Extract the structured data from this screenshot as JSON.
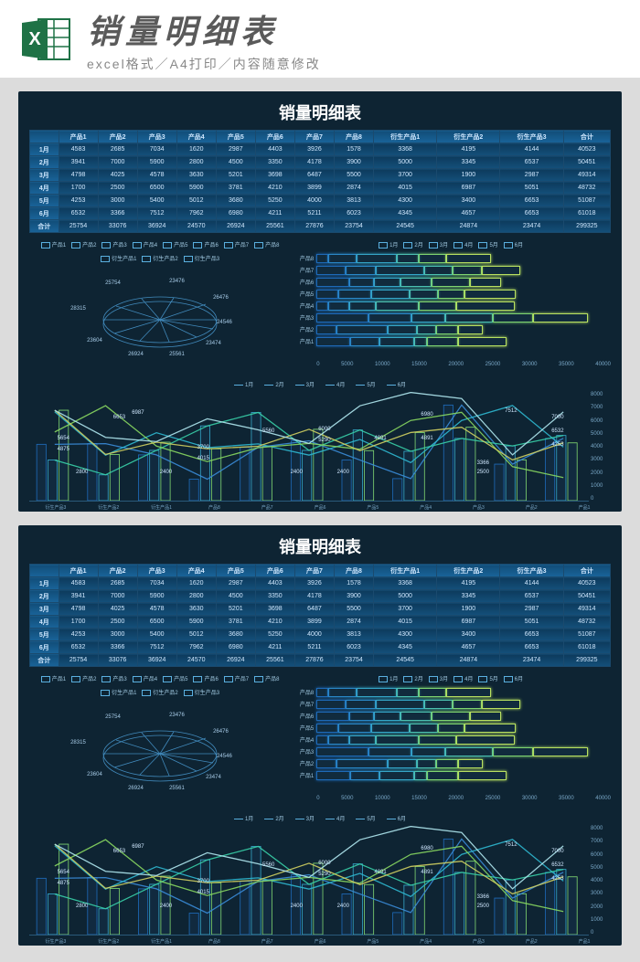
{
  "header": {
    "title": "销量明细表",
    "subtitle": "excel格式／A4打印／内容随意修改"
  },
  "dashboard_title": "销量明细表",
  "columns": [
    "",
    "产品1",
    "产品2",
    "产品3",
    "产品4",
    "产品5",
    "产品6",
    "产品7",
    "产品8",
    "衍生产品1",
    "衍生产品2",
    "衍生产品3",
    "合计"
  ],
  "rows": [
    {
      "label": "1月",
      "cells": [
        4583,
        2685,
        7034,
        1620,
        2987,
        4403,
        3926,
        1578,
        3368,
        4195,
        4144,
        40523
      ]
    },
    {
      "label": "2月",
      "cells": [
        3941,
        7000,
        5900,
        2800,
        4500,
        3350,
        4178,
        3900,
        5000,
        3345,
        6537,
        50451
      ]
    },
    {
      "label": "3月",
      "cells": [
        4798,
        4025,
        4578,
        3630,
        5201,
        3698,
        6487,
        5500,
        3700,
        1900,
        2987,
        49314
      ]
    },
    {
      "label": "4月",
      "cells": [
        1700,
        2500,
        6500,
        5900,
        3781,
        4210,
        3899,
        2874,
        4015,
        6987,
        5051,
        48732
      ]
    },
    {
      "label": "5月",
      "cells": [
        4253,
        3000,
        5400,
        5012,
        3680,
        5250,
        4000,
        3813,
        4300,
        3400,
        6653,
        51087
      ]
    },
    {
      "label": "6月",
      "cells": [
        6532,
        3366,
        7512,
        7962,
        6980,
        4211,
        5211,
        6023,
        4345,
        4657,
        6653,
        61018
      ]
    },
    {
      "label": "合计",
      "cells": [
        25754,
        33076,
        36924,
        24570,
        26924,
        25561,
        27876,
        23754,
        24545,
        24874,
        23474,
        299325
      ]
    }
  ],
  "chart_data": {
    "table": {
      "type": "table",
      "title": "销量明细表",
      "columns": [
        "月份",
        "产品1",
        "产品2",
        "产品3",
        "产品4",
        "产品5",
        "产品6",
        "产品7",
        "产品8",
        "衍生产品1",
        "衍生产品2",
        "衍生产品3",
        "合计"
      ],
      "rows": [
        [
          "1月",
          4583,
          2685,
          7034,
          1620,
          2987,
          4403,
          3926,
          1578,
          3368,
          4195,
          4144,
          40523
        ],
        [
          "2月",
          3941,
          7000,
          5900,
          2800,
          4500,
          3350,
          4178,
          3900,
          5000,
          3345,
          6537,
          50451
        ],
        [
          "3月",
          4798,
          4025,
          4578,
          3630,
          5201,
          3698,
          6487,
          5500,
          3700,
          1900,
          2987,
          49314
        ],
        [
          "4月",
          1700,
          2500,
          6500,
          5900,
          3781,
          4210,
          3899,
          2874,
          4015,
          6987,
          5051,
          48732
        ],
        [
          "5月",
          4253,
          3000,
          5400,
          5012,
          3680,
          5250,
          4000,
          3813,
          4300,
          3400,
          6653,
          51087
        ],
        [
          "6月",
          6532,
          3366,
          7512,
          7962,
          6980,
          4211,
          5211,
          6023,
          4345,
          4657,
          6653,
          61018
        ],
        [
          "合计",
          25754,
          33076,
          36924,
          24570,
          26924,
          25561,
          27876,
          23754,
          24545,
          24874,
          23474,
          299325
        ]
      ]
    },
    "pie": {
      "type": "pie",
      "title": "产品合计占比（线框饼图）",
      "categories": [
        "产品1",
        "产品2",
        "产品3",
        "产品4",
        "产品5",
        "产品6",
        "产品7",
        "产品8",
        "衍生产品1",
        "衍生产品2",
        "衍生产品3"
      ],
      "values": [
        25754,
        33076,
        36924,
        24570,
        26924,
        25561,
        27876,
        23754,
        24545,
        24874,
        23474
      ],
      "data_labels_visible": [
        28315,
        25754,
        23604,
        23476,
        26476,
        24546,
        23474,
        26924,
        25561
      ]
    },
    "stacked_bar": {
      "type": "bar",
      "orientation": "horizontal",
      "stacked": true,
      "categories": [
        "产品1",
        "产品2",
        "产品3",
        "产品4",
        "产品5",
        "产品6",
        "产品7",
        "产品8"
      ],
      "series": [
        {
          "name": "1月",
          "values": [
            4583,
            2685,
            7034,
            1620,
            2987,
            4403,
            3926,
            1578
          ]
        },
        {
          "name": "2月",
          "values": [
            3941,
            7000,
            5900,
            2800,
            4500,
            3350,
            4178,
            3900
          ]
        },
        {
          "name": "3月",
          "values": [
            4798,
            4025,
            4578,
            3630,
            5201,
            3698,
            6487,
            5500
          ]
        },
        {
          "name": "4月",
          "values": [
            1700,
            2500,
            6500,
            5900,
            3781,
            4210,
            3899,
            2874
          ]
        },
        {
          "name": "5月",
          "values": [
            4253,
            3000,
            5400,
            5012,
            3680,
            5250,
            4000,
            3813
          ]
        },
        {
          "name": "6月",
          "values": [
            6532,
            3366,
            7512,
            7962,
            6980,
            4211,
            5211,
            6023
          ]
        }
      ],
      "xlim": [
        0,
        40000
      ],
      "xticks": [
        0,
        5000,
        10000,
        15000,
        20000,
        25000,
        30000,
        35000,
        40000
      ]
    },
    "combo": {
      "type": "line",
      "secondary_type": "bar",
      "categories": [
        "衍生产品3",
        "衍生产品2",
        "衍生产品1",
        "产品8",
        "产品7",
        "产品6",
        "产品5",
        "产品4",
        "产品3",
        "产品2",
        "产品1"
      ],
      "series": [
        {
          "name": "1月",
          "values": [
            4144,
            4195,
            3368,
            1578,
            3926,
            4403,
            2987,
            1620,
            7034,
            2685,
            4583
          ]
        },
        {
          "name": "2月",
          "values": [
            6537,
            3345,
            5000,
            3900,
            4178,
            3350,
            4500,
            2800,
            5900,
            7000,
            3941
          ]
        },
        {
          "name": "3月",
          "values": [
            2987,
            1900,
            3700,
            5500,
            6487,
            3698,
            5201,
            3630,
            4578,
            4025,
            4798
          ]
        },
        {
          "name": "4月",
          "values": [
            5051,
            6987,
            4015,
            2874,
            3899,
            4210,
            3781,
            5900,
            6500,
            2500,
            1700
          ]
        },
        {
          "name": "5月",
          "values": [
            6653,
            3400,
            4300,
            3813,
            4000,
            5250,
            3680,
            5012,
            5400,
            3000,
            4253
          ]
        },
        {
          "name": "6月",
          "values": [
            6653,
            4657,
            4345,
            6023,
            5211,
            4211,
            6980,
            7962,
            7512,
            3366,
            6532
          ]
        }
      ],
      "ylim": [
        0,
        8000
      ],
      "yticks": [
        0,
        1000,
        2000,
        3000,
        4000,
        5000,
        6000,
        7000,
        8000
      ],
      "data_labels_visible": [
        5654,
        4875,
        2800,
        6653,
        6987,
        2400,
        3700,
        4015,
        5560,
        2400,
        6000,
        5290,
        2400,
        4891,
        6980,
        4891,
        3366,
        2500,
        7512,
        4253,
        7000,
        6532
      ]
    }
  },
  "pie_legend": [
    "产品1",
    "产品2",
    "产品3",
    "产品4",
    "产品5",
    "产品6",
    "产品7",
    "产品8",
    "衍生产品1",
    "衍生产品2",
    "衍生产品3"
  ],
  "bar_legend": [
    "1月",
    "2月",
    "3月",
    "4月",
    "5月",
    "6月"
  ],
  "hbar_categories": [
    "产品8",
    "产品7",
    "产品6",
    "产品5",
    "产品4",
    "产品3",
    "产品2",
    "产品1"
  ],
  "hbar_xticks": [
    "0",
    "5000",
    "10000",
    "15000",
    "20000",
    "25000",
    "30000",
    "35000",
    "40000"
  ],
  "combo_yticks": [
    "8000",
    "7000",
    "6000",
    "5000",
    "4000",
    "3000",
    "2000",
    "1000",
    "0"
  ],
  "combo_xlabels": [
    "衍生产品3",
    "衍生产品2",
    "衍生产品1",
    "产品8",
    "产品7",
    "产品6",
    "产品5",
    "产品4",
    "产品3",
    "产品2",
    "产品1"
  ]
}
